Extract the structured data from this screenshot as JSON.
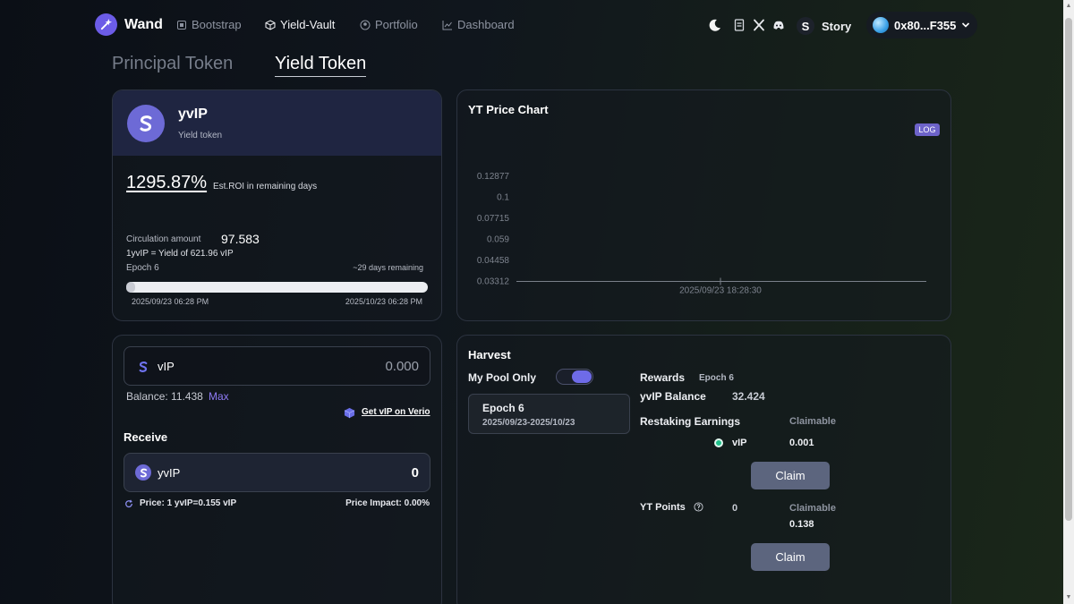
{
  "nav": {
    "brand": "Wand",
    "links": [
      "Bootstrap",
      "Yield-Vault",
      "Portfolio",
      "Dashboard"
    ],
    "network": "Story",
    "wallet": "0x80...F355"
  },
  "tabs": {
    "principal": "Principal Token",
    "yield": "Yield Token"
  },
  "token_card": {
    "name": "yvIP",
    "subtitle": "Yield token",
    "roi": "1295.87%",
    "roi_label": "Est.ROI in remaining days",
    "circulation_label": "Circulation amount",
    "circulation_value": "97.583",
    "rate": "1yvIP = Yield of 621.96 vIP",
    "epoch": "Epoch 6",
    "remaining": "~29 days remaining",
    "progress": 0.03,
    "start_date": "2025/09/23 06:28 PM",
    "end_date": "2025/10/23 06:28 PM"
  },
  "chart": {
    "title": "YT Price Chart",
    "log_badge": "LOG",
    "y_ticks": [
      "0.12877",
      "0.1",
      "0.07715",
      "0.059",
      "0.04458",
      "0.03312"
    ],
    "x_tick": "2025/09/23 18:28:30"
  },
  "chart_data": {
    "type": "line",
    "title": "YT Price Chart",
    "log_scale": true,
    "y_ticks": [
      0.12877,
      0.1,
      0.07715,
      0.059,
      0.04458,
      0.03312
    ],
    "x": [
      "2025/09/23 18:28:30"
    ],
    "series": [
      {
        "values": [
          0.03312
        ]
      }
    ]
  },
  "swap": {
    "input_token": "vIP",
    "input_value": "0.000",
    "balance_label": "Balance: 11.438",
    "max_label": "Max",
    "verio_link": "Get vIP on Verio",
    "receive_label": "Receive",
    "receive_token": "yvIP",
    "receive_value": "0",
    "price": "Price: 1 yvIP=0.155 vIP",
    "impact": "Price Impact: 0.00%"
  },
  "harvest": {
    "title": "Harvest",
    "my_pool_only": "My Pool Only",
    "epoch_title": "Epoch 6",
    "epoch_range": "2025/09/23-2025/10/23",
    "rewards": "Rewards",
    "rewards_epoch": "Epoch 6",
    "yvip_balance_label": "yvIP Balance",
    "yvip_balance": "32.424",
    "restaking_label": "Restaking Earnings",
    "claimable_label": "Claimable",
    "vip_label": "vIP",
    "vip_claimable": "0.001",
    "claim": "Claim",
    "yt_points_label": "YT Points",
    "yt_points": "0",
    "points_claimable_label": "Claimable",
    "points_claimable": "0.138"
  },
  "colors": {
    "accent": "#6d6ad6",
    "link": "#8f7bf5",
    "button": "#5c657e"
  }
}
